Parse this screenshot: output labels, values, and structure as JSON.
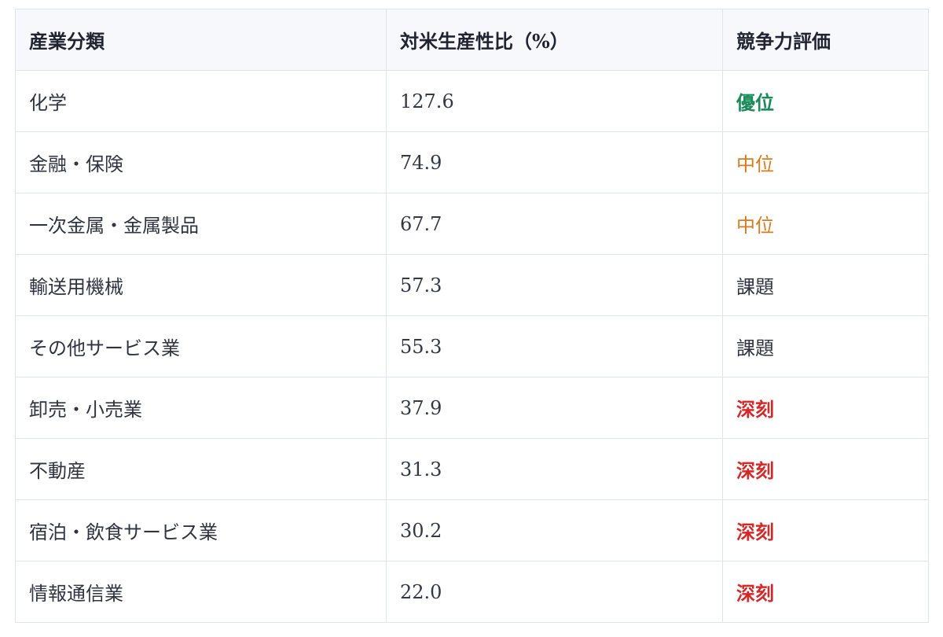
{
  "table": {
    "headers": [
      "産業分類",
      "対米生産性比（%）",
      "競争力評価"
    ],
    "rows": [
      {
        "industry": "化学",
        "ratio": "127.6",
        "rating": "優位",
        "level": "superior"
      },
      {
        "industry": "金融・保険",
        "ratio": "74.9",
        "rating": "中位",
        "level": "middle"
      },
      {
        "industry": "一次金属・金属製品",
        "ratio": "67.7",
        "rating": "中位",
        "level": "middle"
      },
      {
        "industry": "輸送用機械",
        "ratio": "57.3",
        "rating": "課題",
        "level": "issue"
      },
      {
        "industry": "その他サービス業",
        "ratio": "55.3",
        "rating": "課題",
        "level": "issue"
      },
      {
        "industry": "卸売・小売業",
        "ratio": "37.9",
        "rating": "深刻",
        "level": "serious"
      },
      {
        "industry": "不動産",
        "ratio": "31.3",
        "rating": "深刻",
        "level": "serious"
      },
      {
        "industry": "宿泊・飲食サービス業",
        "ratio": "30.2",
        "rating": "深刻",
        "level": "serious"
      },
      {
        "industry": "情報通信業",
        "ratio": "22.0",
        "rating": "深刻",
        "level": "serious"
      }
    ]
  },
  "colors": {
    "superior": "#1a8a5a",
    "middle": "#d97a1f",
    "issue": "#2f3440",
    "serious": "#d62828",
    "border": "#dfe4ec",
    "header_bg": "#f6f8fb"
  }
}
